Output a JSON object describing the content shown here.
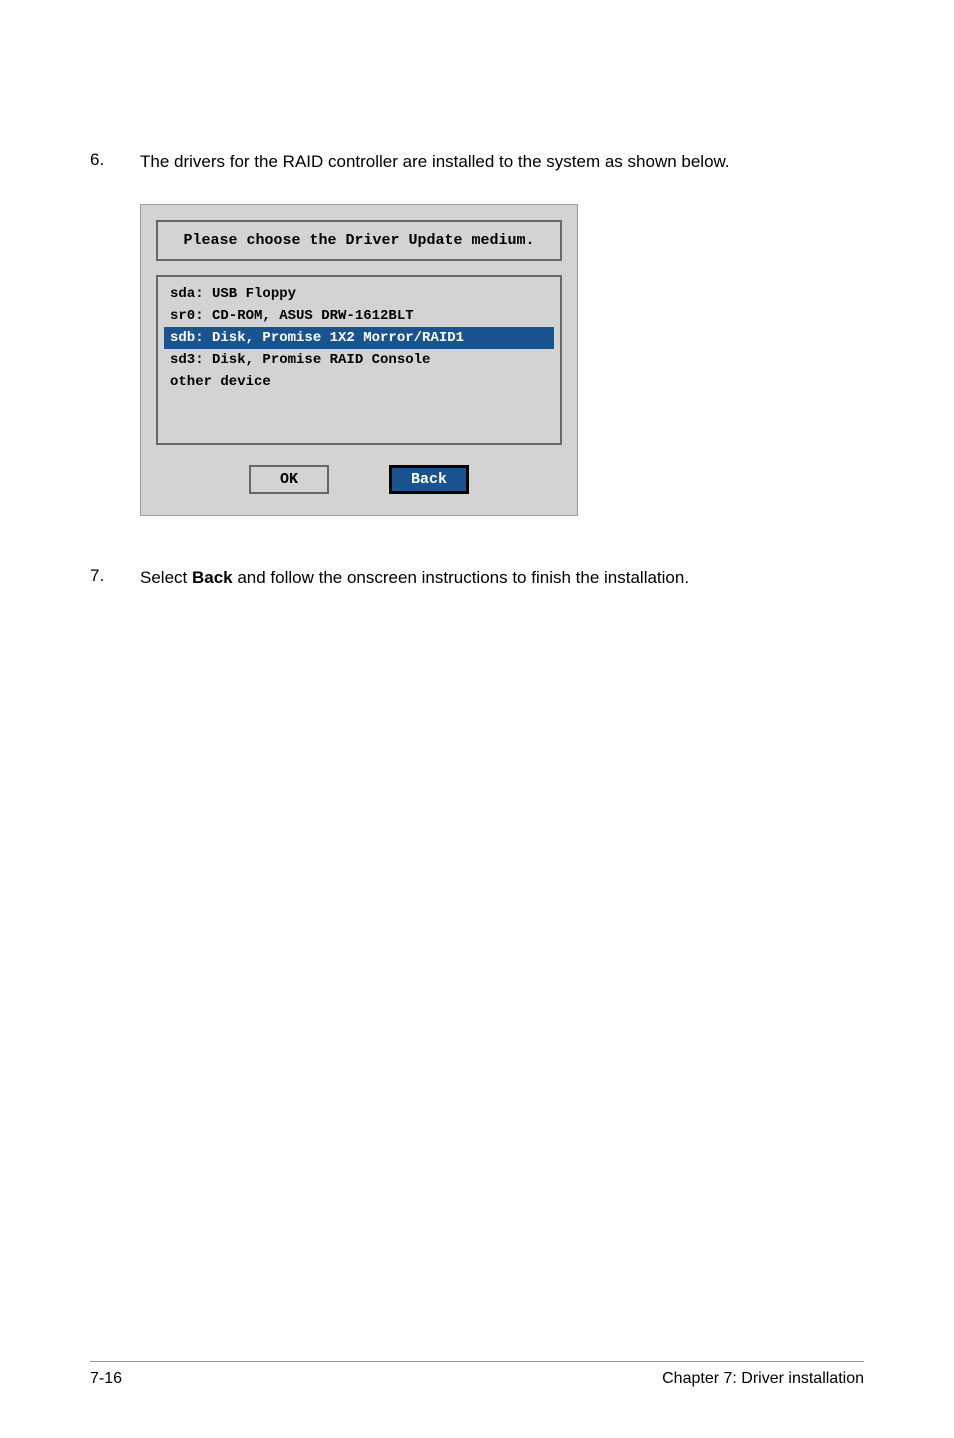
{
  "step6": {
    "number": "6.",
    "text": "The drivers for the RAID controller are installed to the system as shown below."
  },
  "dialog": {
    "title": "Please choose the Driver Update medium.",
    "items": [
      {
        "label": "sda: USB Floppy",
        "selected": false
      },
      {
        "label": "sr0: CD-ROM, ASUS DRW-1612BLT",
        "selected": false
      },
      {
        "label": "sdb: Disk, Promise 1X2 Morror/RAID1",
        "selected": true
      },
      {
        "label": "sd3: Disk, Promise RAID Console",
        "selected": false
      },
      {
        "label": "other device",
        "selected": false
      }
    ],
    "ok_label": "OK",
    "back_label": "Back"
  },
  "step7": {
    "number": "7.",
    "text_prefix": "Select ",
    "text_bold": "Back",
    "text_suffix": " and follow the onscreen instructions to finish the installation."
  },
  "footer": {
    "page": "7-16",
    "chapter": "Chapter 7: Driver installation"
  }
}
